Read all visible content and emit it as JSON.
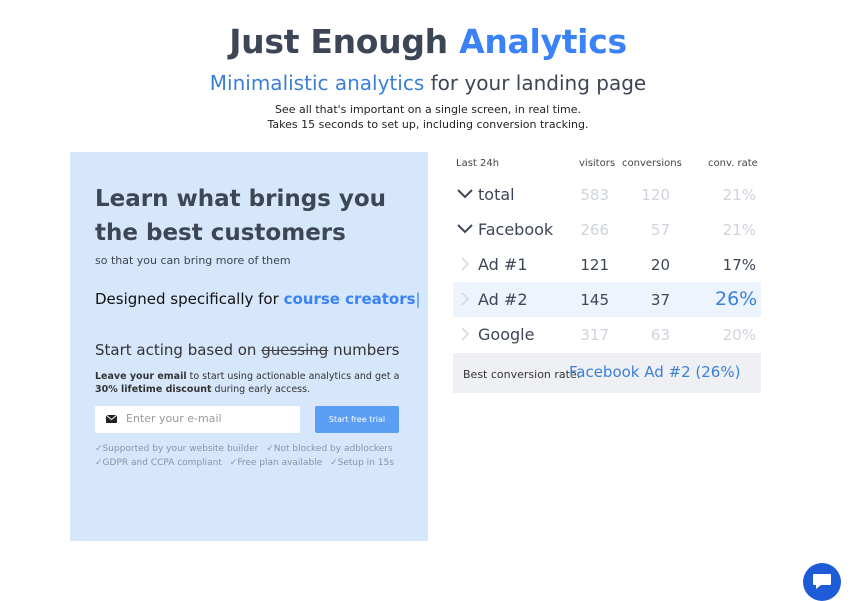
{
  "hero": {
    "title_main": "Just Enough ",
    "title_accent": "Analytics",
    "subtitle_accent": "Minimalistic analytics",
    "subtitle_rest": " for your landing page",
    "desc_line1": "See all that's important on a single screen, in real time.",
    "desc_line2": "Takes 15 seconds to set up, including conversion tracking."
  },
  "panel": {
    "title": "Learn what brings you the best customers",
    "subtitle": "so that you can bring more of them",
    "designed_prefix": "Designed specifically for ",
    "designed_accent": "course creators",
    "designed_caret": "|",
    "start_prefix": "Start acting based on ",
    "start_strike": "guessing",
    "start_suffix": " numbers",
    "leave_bold1": "Leave your email",
    "leave_mid": " to start using actionable analytics and get a ",
    "leave_bold2": "30% lifetime discount",
    "leave_end": " during early access.",
    "email_placeholder": "Enter your e-mail",
    "trial_button": "Start free trial",
    "features_row1": [
      "✓Supported by your website builder",
      "✓Not blocked by adblockers"
    ],
    "features_row2": [
      "✓GDPR and CCPA compliant",
      "✓Free plan available",
      "✓Setup in 15s"
    ]
  },
  "stats": {
    "period": "Last 24h",
    "col_visitors": "visitors",
    "col_conversions": "conversions",
    "col_rate": "conv. rate",
    "rows": [
      {
        "name": "total",
        "visitors": "583",
        "conversions": "120",
        "rate": "21%",
        "icon": "chevron-down-icon"
      },
      {
        "name": "Facebook",
        "visitors": "266",
        "conversions": "57",
        "rate": "21%",
        "icon": "chevron-down-icon"
      },
      {
        "name": "Ad #1",
        "visitors": "121",
        "conversions": "20",
        "rate": "17%",
        "icon": "chevron-right-icon"
      },
      {
        "name": "Ad #2",
        "visitors": "145",
        "conversions": "37",
        "rate": "26%",
        "icon": "chevron-right-icon"
      },
      {
        "name": "Google",
        "visitors": "317",
        "conversions": "63",
        "rate": "20%",
        "icon": "chevron-right-icon"
      }
    ],
    "best_label": "Best conversion rate:",
    "best_value": "Facebook Ad #2 (26%)"
  },
  "chat": {
    "icon": "chat-bubble-icon"
  },
  "colors": {
    "accent": "#3b82f6",
    "panel": "#d6e6fb",
    "button": "#5b9ef5",
    "chat": "#1e5bd6"
  }
}
